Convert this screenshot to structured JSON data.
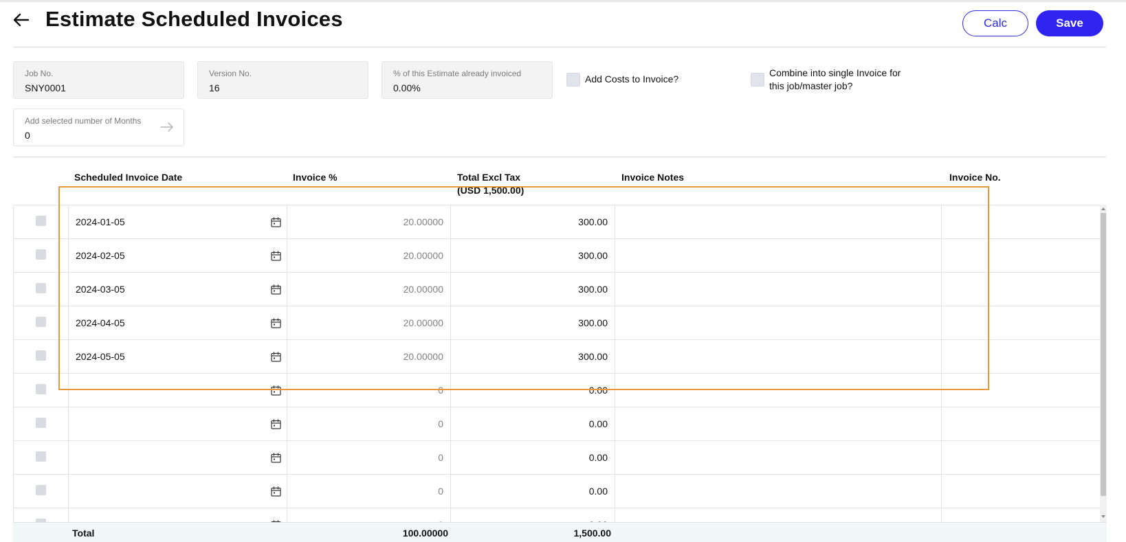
{
  "header": {
    "title": "Estimate Scheduled Invoices",
    "calc_label": "Calc",
    "save_label": "Save"
  },
  "fields": {
    "job_no": {
      "label": "Job No.",
      "value": "SNY0001"
    },
    "version_no": {
      "label": "Version No.",
      "value": "16"
    },
    "pct_invoiced": {
      "label": "% of this Estimate already invoiced",
      "value": "0.00%"
    },
    "add_months": {
      "label": "Add selected number of Months",
      "value": "0"
    }
  },
  "options": {
    "add_costs": "Add Costs to Invoice?",
    "combine_line1": "Combine into single Invoice for",
    "combine_line2": "this job/master job?"
  },
  "table": {
    "columns": {
      "date": "Scheduled Invoice Date",
      "pct": "Invoice %",
      "total_line1": "Total Excl Tax",
      "total_line2": "(USD 1,500.00)",
      "notes": "Invoice Notes",
      "invoice_no": "Invoice No."
    },
    "rows": [
      {
        "date": "2024-01-05",
        "pct": "20.00000",
        "total": "300.00",
        "notes": "",
        "invoice_no": ""
      },
      {
        "date": "2024-02-05",
        "pct": "20.00000",
        "total": "300.00",
        "notes": "",
        "invoice_no": ""
      },
      {
        "date": "2024-03-05",
        "pct": "20.00000",
        "total": "300.00",
        "notes": "",
        "invoice_no": ""
      },
      {
        "date": "2024-04-05",
        "pct": "20.00000",
        "total": "300.00",
        "notes": "",
        "invoice_no": ""
      },
      {
        "date": "2024-05-05",
        "pct": "20.00000",
        "total": "300.00",
        "notes": "",
        "invoice_no": ""
      },
      {
        "date": "",
        "pct": "0",
        "total": "0.00",
        "notes": "",
        "invoice_no": ""
      },
      {
        "date": "",
        "pct": "0",
        "total": "0.00",
        "notes": "",
        "invoice_no": ""
      },
      {
        "date": "",
        "pct": "0",
        "total": "0.00",
        "notes": "",
        "invoice_no": ""
      },
      {
        "date": "",
        "pct": "0",
        "total": "0.00",
        "notes": "",
        "invoice_no": ""
      },
      {
        "date": "",
        "pct": "0",
        "total": "0.00",
        "notes": "",
        "invoice_no": ""
      }
    ],
    "totals": {
      "label": "Total",
      "pct": "100.00000",
      "total": "1,500.00"
    }
  },
  "icons": {
    "back": "arrow-left-icon",
    "calendar": "calendar-icon",
    "arrow_right": "arrow-right-icon"
  },
  "colors": {
    "primary": "#2f24f0",
    "highlight": "#e8973a",
    "totals_bg": "#f1f7f7"
  }
}
